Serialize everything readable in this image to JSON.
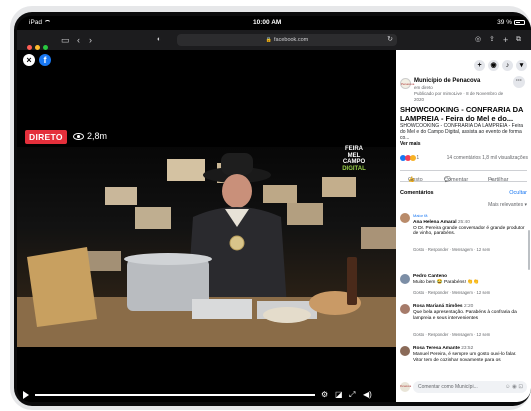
{
  "status_bar": {
    "device": "iPad",
    "time": "10:00 AM",
    "battery": "39 %"
  },
  "browser": {
    "url": "facebook.com",
    "traffic_lights": [
      "#ff5f57",
      "#febc2e",
      "#28c840"
    ],
    "icons": [
      "sidebar-icon",
      "back-icon",
      "forward-icon",
      "privacy-icon",
      "reload-icon",
      "share-icon",
      "new-tab-icon",
      "tabs-icon"
    ]
  },
  "video": {
    "live_label": "DIRETO",
    "viewers": "2,8m",
    "logo_lines": [
      "FEIRA",
      "MEL",
      "CAMPO",
      "DIGITAL"
    ],
    "progress": 1.0
  },
  "sidebar": {
    "page_name": "Município de Penacova",
    "page_status": "em direto",
    "published_by": "Publicado por mimoLive",
    "published_date": "8 de Novembro de 2020",
    "avatar_text": "Penacova",
    "post_title": "SHOWCOOKING - CONFRARIA DA LAMPREIA - Feira do Mel e do...",
    "post_body": "SHOWCOOKING - CONFRARIA DA LAMPREIA - Feira do Mel e do Campo Digital, assista ao evento de forma co...",
    "see_more": "Ver mais",
    "reaction_count": "1",
    "comments_count": "14 comentários",
    "views": "1,8 mil visualizações",
    "like": "Gosto",
    "comment": "Comentar",
    "share": "Partilhar",
    "comments_header": "Comentários",
    "hide": "Ocultar",
    "relevance": "Mais relevantes",
    "comments": [
      {
        "tag": "Maior fã",
        "author": "Ana Helena Amaral",
        "time": "25:40",
        "text": "O Dr. Pereira grande conversador é grande produtor de vinho, parabéns.",
        "actions": "Gosto · Responder · Mensagem · 12 sem",
        "color": "#b98b6a"
      },
      {
        "tag": "",
        "author": "Pedro Canteno",
        "time": "",
        "text": "Muito bem 😂 Parabéns! 👏👏",
        "actions": "Gosto · Responder · Mensagem · 12 sem",
        "color": "#7c8ea6"
      },
      {
        "tag": "",
        "author": "Rosa Marianá Simões",
        "time": "2:20",
        "text": "Que bela apresentação. Parabéns à confraria da lampreia e seus intervenientes",
        "actions": "Gosto · Responder · Mensagem · 12 sem",
        "color": "#a67b6a"
      },
      {
        "tag": "",
        "author": "Rosa Teresa Amante",
        "time": "23:52",
        "text": "Manuel Pereira, é sempre um gosto ouvi-lo falar. Vitor tem de cozinhar novamente para os",
        "actions": "",
        "color": "#8a6a58"
      }
    ],
    "composer_placeholder": "Comentar como Municípi..."
  }
}
